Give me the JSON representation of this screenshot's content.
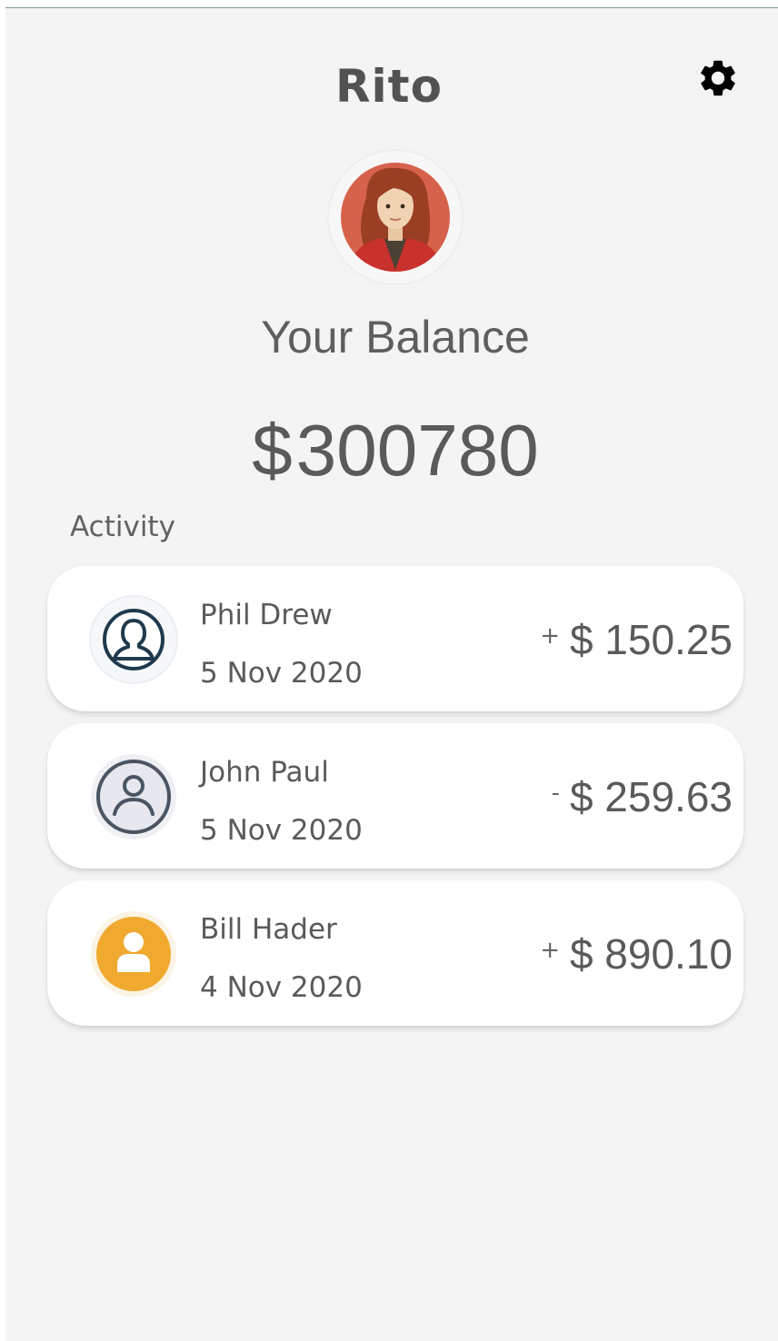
{
  "app": {
    "title": "Rito"
  },
  "header": {
    "settings_icon": "gear-icon"
  },
  "profile": {
    "avatar_icon": "woman-avatar-icon"
  },
  "balance": {
    "label": "Your Balance",
    "currency": "$",
    "amount": "300780"
  },
  "activity": {
    "label": "Activity",
    "items": [
      {
        "name": "Phil Drew",
        "date": "5 Nov 2020",
        "sign": "+",
        "amount": "$ 150.25",
        "icon": "user-outline-icon"
      },
      {
        "name": "John Paul",
        "date": "5 Nov 2020",
        "sign": "-",
        "amount": "$ 259.63",
        "icon": "user-circle-icon"
      },
      {
        "name": "Bill Hader",
        "date": "4 Nov 2020",
        "sign": "+",
        "amount": "$ 890.10",
        "icon": "user-filled-icon"
      }
    ]
  },
  "colors": {
    "background": "#f4f4f4",
    "card": "#ffffff",
    "text": "#5a5a5a",
    "icon_orange": "#f0a92f",
    "icon_navy": "#1f3a4d"
  }
}
